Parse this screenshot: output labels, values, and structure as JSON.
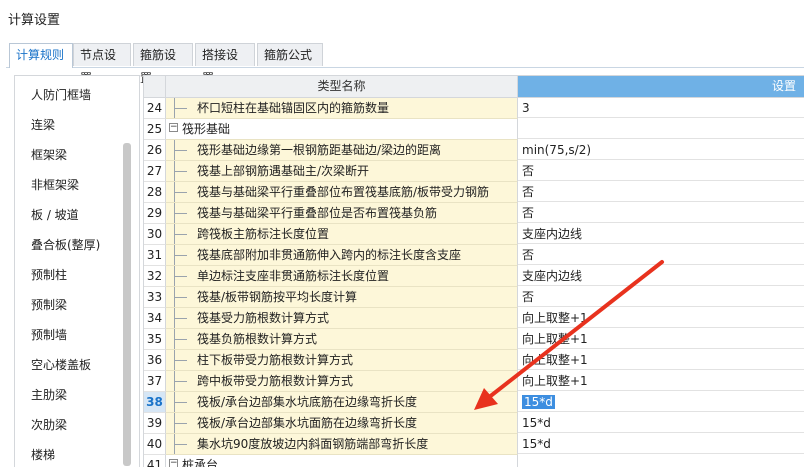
{
  "window": {
    "title": "计算设置"
  },
  "tabs": [
    {
      "label": "计算规则",
      "active": true
    },
    {
      "label": "节点设置",
      "active": false
    },
    {
      "label": "箍筋设置",
      "active": false
    },
    {
      "label": "搭接设置",
      "active": false
    },
    {
      "label": "箍筋公式",
      "active": false
    }
  ],
  "sidebar": {
    "items": [
      "人防门框墙",
      "连梁",
      "框架梁",
      "非框架梁",
      "板 / 坡道",
      "叠合板(整厚)",
      "预制柱",
      "预制梁",
      "预制墙",
      "空心楼盖板",
      "主肋梁",
      "次肋梁",
      "楼梯"
    ]
  },
  "grid": {
    "header_name": "类型名称",
    "header_value": "设置值",
    "rows": [
      {
        "num": "24",
        "name": "杯口短柱在基础锚固区内的箍筋数量",
        "value": "3"
      },
      {
        "num": "25",
        "name": "筏形基础",
        "value": "",
        "group": true,
        "toggle": "−"
      },
      {
        "num": "26",
        "name": "筏形基础边缘第一根钢筋距基础边/梁边的距离",
        "value": "min(75,s/2)"
      },
      {
        "num": "27",
        "name": "筏基上部钢筋遇基础主/次梁断开",
        "value": "否"
      },
      {
        "num": "28",
        "name": "筏基与基础梁平行重叠部位布置筏基底筋/板带受力钢筋",
        "value": "否"
      },
      {
        "num": "29",
        "name": "筏基与基础梁平行重叠部位是否布置筏基负筋",
        "value": "否"
      },
      {
        "num": "30",
        "name": "跨筏板主筋标注长度位置",
        "value": "支座内边线"
      },
      {
        "num": "31",
        "name": "筏基底部附加非贯通筋伸入跨内的标注长度含支座",
        "value": "否"
      },
      {
        "num": "32",
        "name": "单边标注支座非贯通筋标注长度位置",
        "value": "支座内边线"
      },
      {
        "num": "33",
        "name": "筏基/板带钢筋按平均长度计算",
        "value": "否"
      },
      {
        "num": "34",
        "name": "筏基受力筋根数计算方式",
        "value": "向上取整+1"
      },
      {
        "num": "35",
        "name": "筏基负筋根数计算方式",
        "value": "向上取整+1"
      },
      {
        "num": "36",
        "name": "柱下板带受力筋根数计算方式",
        "value": "向上取整+1"
      },
      {
        "num": "37",
        "name": "跨中板带受力筋根数计算方式",
        "value": "向上取整+1"
      },
      {
        "num": "38",
        "name": "筏板/承台边部集水坑底筋在边缘弯折长度",
        "value": "15*d",
        "selected": true
      },
      {
        "num": "39",
        "name": "筏板/承台边部集水坑面筋在边缘弯折长度",
        "value": "15*d"
      },
      {
        "num": "40",
        "name": "集水坑90度放坡边内斜面钢筋端部弯折长度",
        "value": "15*d"
      },
      {
        "num": "41",
        "name": "桩承台",
        "value": "",
        "group": true,
        "toggle": "−"
      }
    ]
  },
  "annotation": {
    "arrow_color": "#e8321e"
  }
}
